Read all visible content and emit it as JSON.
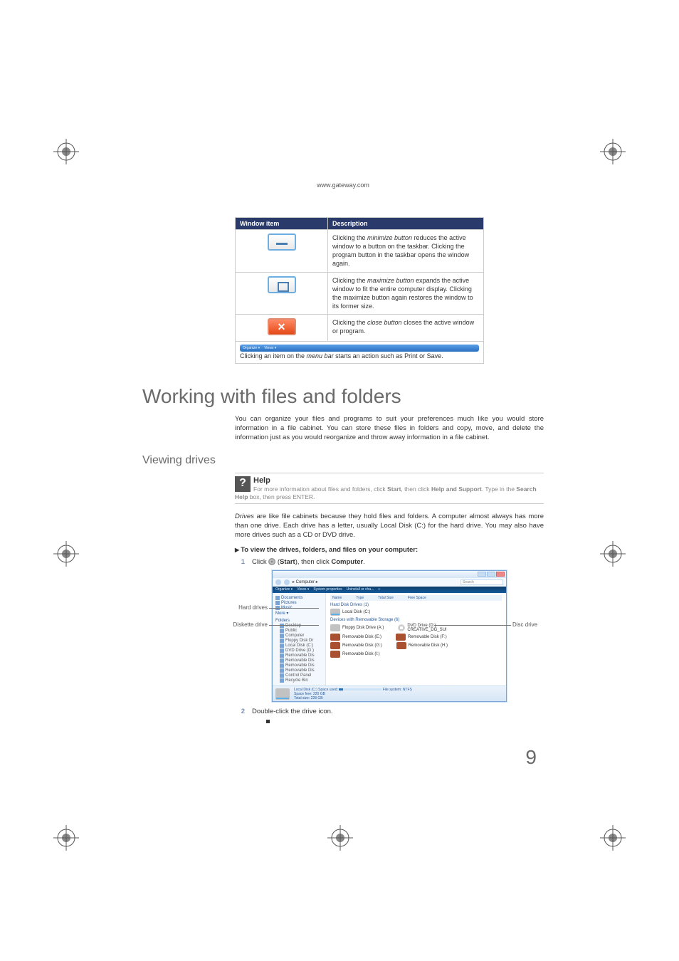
{
  "header_url": "www.gateway.com",
  "win_table": {
    "col1": "Window item",
    "col2": "Description",
    "rows": [
      {
        "desc_pre": "Clicking the ",
        "desc_em": "minimize button",
        "desc_post": " reduces the active window to a button on the taskbar. Clicking the program button in the taskbar opens the window again."
      },
      {
        "desc_pre": "Clicking the ",
        "desc_em": "maximize button",
        "desc_post": " expands the active window to fit the entire computer display. Clicking the maximize button again restores the window to its former size."
      },
      {
        "desc_pre": "Clicking the ",
        "desc_em": "close button",
        "desc_post": " closes the active window or program."
      }
    ],
    "menubar_pre": "Clicking an item on the ",
    "menubar_em": "menu bar",
    "menubar_post": " starts an action such as Print or Save.",
    "menubar_items": [
      "Organize ▾",
      "Views ▾"
    ]
  },
  "h1": "Working with files and folders",
  "intro": "You can organize your files and programs to suit your preferences much like you would store information in a file cabinet. You can store these files in folders and copy, move, and delete the information just as you would reorganize and throw away information in a file cabinet.",
  "h2": "Viewing drives",
  "help": {
    "title": "Help",
    "t1": "For more information about files and folders, click ",
    "b1": "Start",
    "t2": ", then click ",
    "b2": "Help and Support",
    "t3": ". Type ",
    "kw": "",
    "t4": " in the ",
    "b3": "Search Help",
    "t5": " box, then press ",
    "k1": "ENTER",
    "t6": "."
  },
  "drives_em": "Drives",
  "drives_text": " are like file cabinets because they hold files and folders. A computer almost always has more than one drive. Each drive has a letter, usually Local Disk (C:) for the hard drive. You may also have more drives such as a CD or DVD drive.",
  "proc_title": "To view the drives, folders, and files on your computer:",
  "step1_a": "Click ",
  "step1_b": " (",
  "step1_c": "Start",
  "step1_d": "), then click ",
  "step1_e": "Computer",
  "step1_f": ".",
  "step2": "Double-click the drive icon.",
  "labels": {
    "hd": "Hard drives",
    "dd": "Diskette drive",
    "disc": "Disc drive"
  },
  "explorer": {
    "addr": "▸ Computer ▸",
    "search": "Search",
    "toolbar": [
      "Organize ▾",
      "Views ▾",
      "System properties",
      "Uninstall or cha...",
      "»"
    ],
    "cols": [
      "Name",
      "Type",
      "Total Size",
      "Free Space"
    ],
    "side": [
      "Documents",
      "Pictures",
      "Music",
      "More ▾"
    ],
    "side2": [
      "Folders",
      "Desktop",
      "Public",
      "Computer",
      "Floppy Disk Dr",
      "Local Disk (C:)",
      "DVD Drive (D:)",
      "Removable Dis",
      "Removable Dis",
      "Removable Dis",
      "Removable Dis",
      "Control Panel",
      "Recycle Bin"
    ],
    "g1": "Hard Disk Drives (1)",
    "d1": "Local Disk (C:)",
    "g2": "Devices with Removable Storage (6)",
    "d2a": "Floppy Disk Drive (A:)",
    "d2b_a": "DVD Drive (D:)",
    "d2b_b": "CREATIVE_DG_SUI",
    "d3a": "Removable Disk (E:)",
    "d3b": "Removable Disk (F:)",
    "d4a": "Removable Disk (G:)",
    "d4b": "Removable Disk (H:)",
    "d5": "Removable Disk (I:)",
    "foot1": "Local Disk (C:)  Space used:",
    "foot2": "File system: NTFS",
    "foot3": "Space free: 220 GB",
    "foot4": "Total size: 228 GB"
  },
  "page_num": "9"
}
